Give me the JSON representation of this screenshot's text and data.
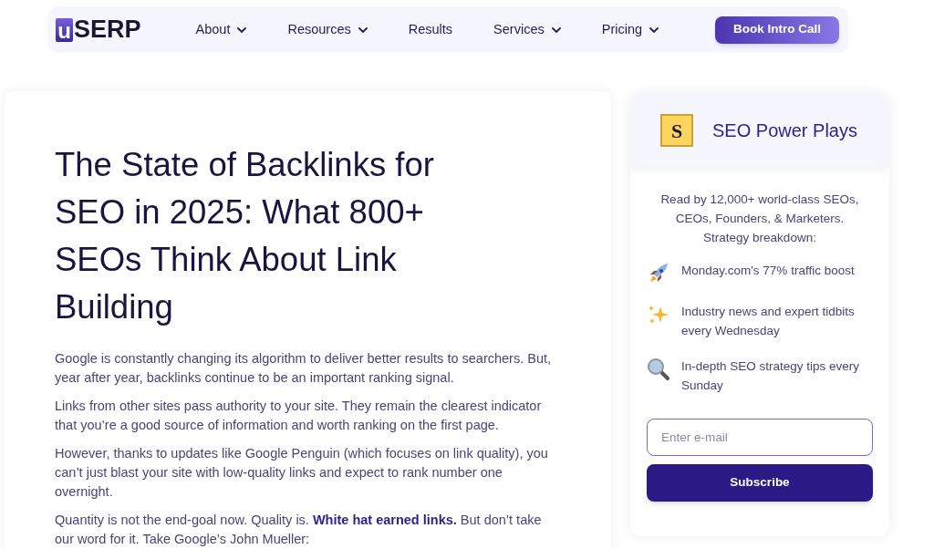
{
  "logo": {
    "mark": "u",
    "text": "SERP"
  },
  "nav": [
    {
      "label": "About",
      "dropdown": true
    },
    {
      "label": "Resources",
      "dropdown": true
    },
    {
      "label": "Results",
      "dropdown": false
    },
    {
      "label": "Services",
      "dropdown": true
    },
    {
      "label": "Pricing",
      "dropdown": true
    }
  ],
  "cta": "Book Intro Call",
  "article": {
    "title": "The State of Backlinks for SEO in 2025: What 800+ SEOs Think About Link Building",
    "paragraphs": [
      {
        "text": "Google is constantly changing its algorithm to deliver better results to searchers. But, year after year, backlinks continue to be an important ranking signal."
      },
      {
        "text": "Links from other sites pass authority to your site. They remain the clearest indicator that you’re a good source of information and worth ranking on the first page."
      },
      {
        "text": "However, thanks to updates like Google Penguin (which focuses on link quality), you can’t just blast your site with low-quality links and expect to rank number one overnight."
      },
      {
        "text": "Quantity is not the end-goal now. Quality is. ",
        "link": "White hat earned links.",
        "after": " But don’t take our word for it. Take Google’s John Mueller:"
      }
    ]
  },
  "newsletter": {
    "badge": "S",
    "title": "SEO Power Plays",
    "intro": "Read by 12,000+ world-class SEOs, CEOs, Founders, & Marketers. Strategy breakdown:",
    "perks": [
      {
        "kind": "rocket",
        "text": "Monday.com's 77% traffic boost"
      },
      {
        "kind": "sparkles",
        "text": "Industry news and expert tidbits every Wednesday"
      },
      {
        "kind": "magnifier",
        "text": "In-depth SEO strategy tips every Sunday"
      }
    ],
    "email": {
      "placeholder": "Enter e-mail"
    },
    "button": "Subscribe"
  }
}
